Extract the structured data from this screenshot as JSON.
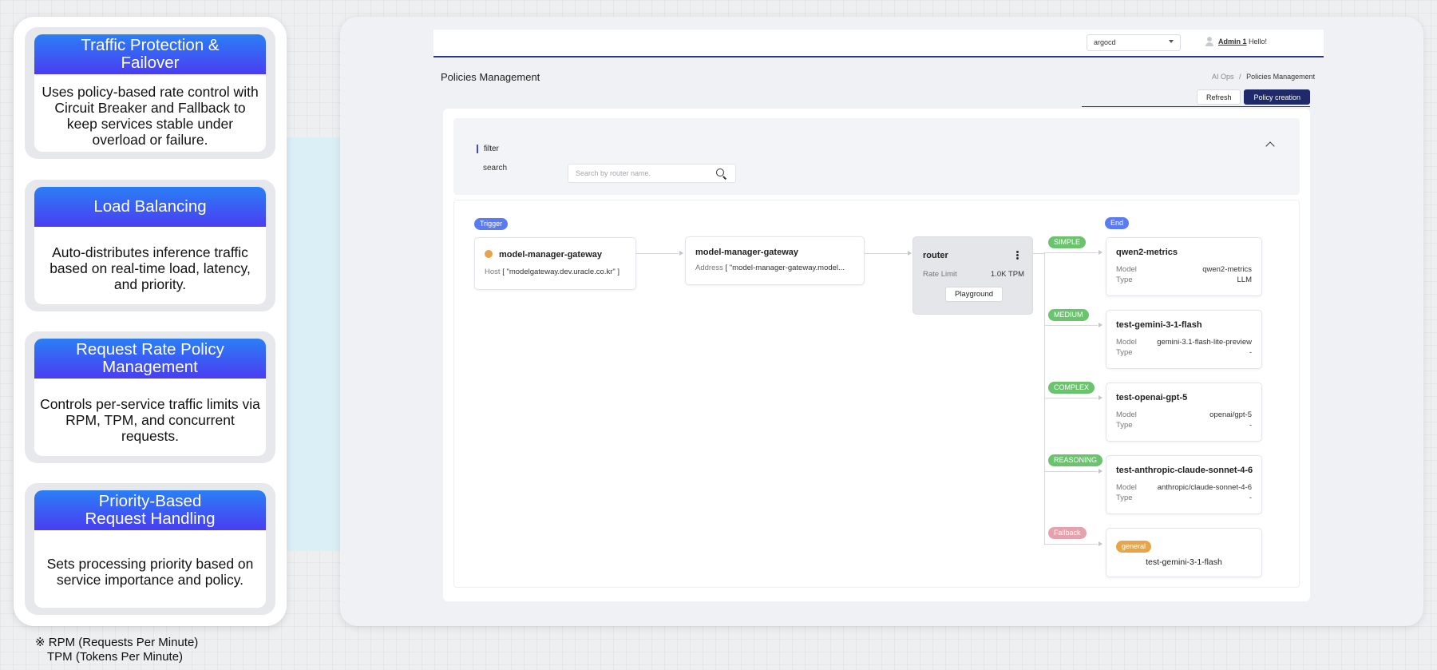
{
  "features": [
    {
      "title": "Traffic Protection &\nFailover",
      "desc": "Uses policy-based rate control with Circuit Breaker and Fallback to keep services stable under overload or failure."
    },
    {
      "title": "Load Balancing",
      "desc": "Auto-distributes inference traffic based on real-time load, latency, and priority."
    },
    {
      "title": "Request Rate Policy Management",
      "desc": "Controls per-service traffic limits via RPM, TPM, and concurrent requests."
    },
    {
      "title": "Priority-Based\nRequest Handling",
      "desc": "Sets processing priority based on service importance and policy."
    }
  ],
  "footnote": {
    "line1": "※ RPM (Requests Per Minute)",
    "line2": "TPM (Tokens Per Minute)"
  },
  "topbar": {
    "namespace": "argocd",
    "user_name": "Admin 1",
    "greeting": "Hello!"
  },
  "page": {
    "title": "Policies Management",
    "breadcrumb_parent": "AI Ops",
    "breadcrumb_sep": "/",
    "breadcrumb_current": "Policies Management",
    "refresh_label": "Refresh",
    "create_label": "Policy creation"
  },
  "filter": {
    "label": "filter",
    "search_label": "search",
    "search_placeholder": "Search by router name."
  },
  "flow": {
    "trigger_label": "Trigger",
    "end_label": "End",
    "trigger_node": {
      "title": "model-manager-gateway",
      "key": "Host",
      "value": "[ \"modelgateway.dev.uracle.co.kr\" ]"
    },
    "gateway_node": {
      "title": "model-manager-gateway",
      "key": "Address",
      "value": "[ \"model-manager-gateway.model..."
    },
    "router_node": {
      "title": "router",
      "rate_key": "Rate Limit",
      "rate_value": "1.0K TPM",
      "playground_label": "Playground"
    },
    "routes": [
      {
        "tag": "SIMPLE",
        "title": "qwen2-metrics",
        "model_key": "Model",
        "model": "qwen2-metrics",
        "type_key": "Type",
        "type": "LLM"
      },
      {
        "tag": "MEDIUM",
        "title": "test-gemini-3-1-flash",
        "model_key": "Model",
        "model": "gemini-3.1-flash-lite-preview",
        "type_key": "Type",
        "type": "-"
      },
      {
        "tag": "COMPLEX",
        "title": "test-openai-gpt-5",
        "model_key": "Model",
        "model": "openai/gpt-5",
        "type_key": "Type",
        "type": "-"
      },
      {
        "tag": "REASONING",
        "title": "test-anthropic-claude-sonnet-4-6",
        "model_key": "Model",
        "model": "anthropic/claude-sonnet-4-6",
        "type_key": "Type",
        "type": "-"
      }
    ],
    "fallback": {
      "tag": "Fallback",
      "badge": "general",
      "target": "test-gemini-3-1-flash"
    }
  },
  "colors": {
    "accent_dark": "#1f2a6b",
    "feature_gradient_top": "#2a7ff5",
    "feature_gradient_bottom": "#4a3df2",
    "route_tag": "#6cc36e",
    "fallback_tag": "#e3a2ad",
    "trigger_tag": "#5b7cf0",
    "status_dot": "#e6a24c"
  }
}
